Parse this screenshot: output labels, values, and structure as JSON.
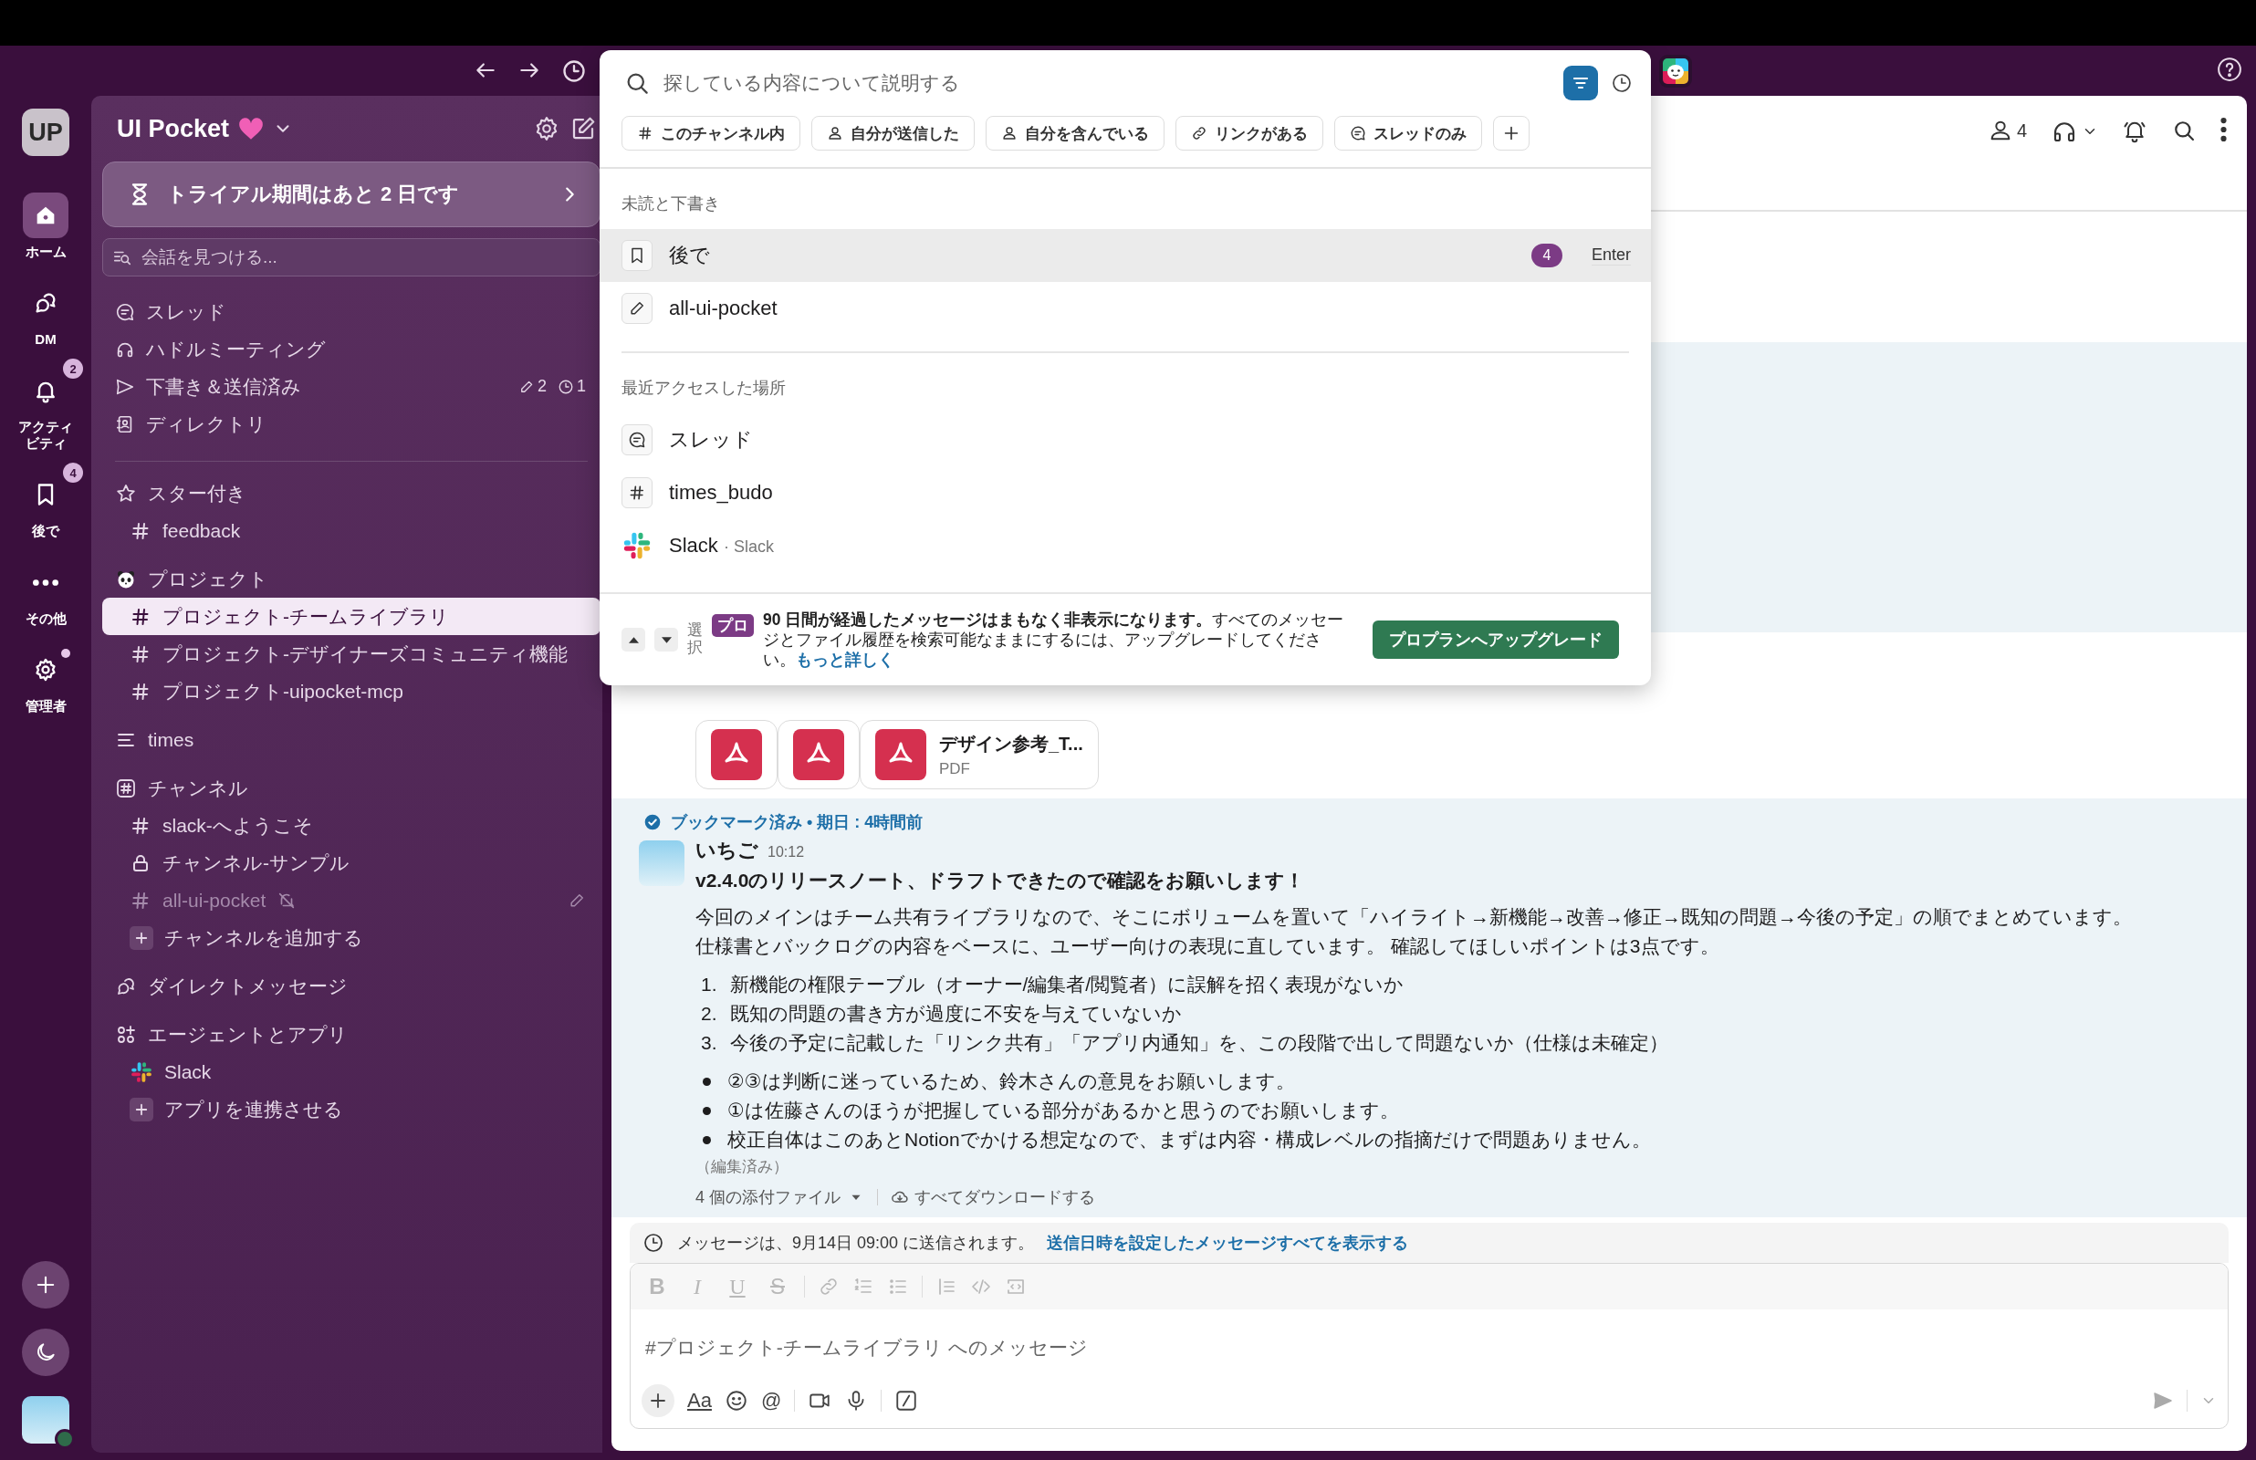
{
  "rail": {
    "workspace_initials": "UP",
    "items": [
      {
        "kind": "home",
        "label": "ホーム",
        "selected": true,
        "dot": false
      },
      {
        "kind": "dm",
        "label": "DM",
        "selected": false,
        "dot": false
      },
      {
        "kind": "activity",
        "label": "アクティビティ",
        "selected": false,
        "badge": "2",
        "dot": false
      },
      {
        "kind": "later",
        "label": "後で",
        "selected": false,
        "badge": "4",
        "dot": false
      },
      {
        "kind": "more",
        "label": "その他",
        "selected": false,
        "dot": false
      },
      {
        "kind": "admin",
        "label": "管理者",
        "selected": false,
        "dot": true
      }
    ]
  },
  "sidebar": {
    "workspace": "UI Pocket",
    "trial_banner": "トライアル期間はあと 2 日です",
    "find_placeholder": "会話を見つける...",
    "nav": [
      {
        "kind": "threads",
        "label": "スレッド"
      },
      {
        "kind": "huddle",
        "label": "ハドルミーティング"
      },
      {
        "kind": "drafts",
        "label": "下書き＆送信済み",
        "draft_count": "2",
        "scheduled_count": "1"
      },
      {
        "kind": "directory",
        "label": "ディレクトリ"
      }
    ],
    "sections": [
      {
        "kind": "star",
        "title": "スター付き",
        "items": [
          {
            "kind": "hash",
            "label": "feedback",
            "selected": false,
            "muted": false,
            "draft": false
          }
        ]
      },
      {
        "kind": "project",
        "title": "プロジェクト",
        "items": [
          {
            "kind": "hash",
            "label": "プロジェクト-チームライブラリ",
            "selected": true,
            "muted": false,
            "draft": false
          },
          {
            "kind": "hash",
            "label": "プロジェクト-デザイナーズコミュニティ機能",
            "selected": false,
            "muted": false,
            "draft": false
          },
          {
            "kind": "hash",
            "label": "プロジェクト-uipocket-mcp",
            "selected": false,
            "muted": false,
            "draft": false
          }
        ]
      },
      {
        "kind": "list",
        "title": "times"
      },
      {
        "kind": "channels",
        "title": "チャンネル",
        "items": [
          {
            "kind": "hash",
            "label": "slack-へようこそ",
            "selected": false,
            "muted": false,
            "draft": false
          },
          {
            "kind": "lock",
            "label": "チャンネル-サンプル",
            "selected": false,
            "muted": false,
            "draft": false
          },
          {
            "kind": "hash",
            "label": "all-ui-pocket",
            "selected": false,
            "muted": true,
            "draft": true
          },
          {
            "kind": "add",
            "label": "チャンネルを追加する",
            "selected": false,
            "muted": false,
            "draft": false
          }
        ]
      },
      {
        "kind": "dm",
        "title": "ダイレクトメッセージ"
      },
      {
        "kind": "apps",
        "title": "エージェントとアプリ",
        "items": [
          {
            "kind": "app",
            "label": "Slack",
            "selected": false,
            "muted": false,
            "draft": false
          },
          {
            "kind": "add",
            "label": "アプリを連携させる",
            "selected": false,
            "muted": false,
            "draft": false
          }
        ]
      }
    ]
  },
  "channel_header": {
    "member_count": "4"
  },
  "messages": {
    "attachments": [
      {
        "kind": "pdf"
      },
      {
        "kind": "pdf"
      },
      {
        "kind": "pdf",
        "name": "デザイン参考_T...",
        "type": "PDF"
      }
    ],
    "message": {
      "bookmark_status": "ブックマーク済み • 期日 : 4時間前",
      "author": "いちご",
      "time": "10:12",
      "title": "v2.4.0のリリースノート、ドラフトできたので確認をお願いします！",
      "paragraph_lines": [
        "今回のメインはチーム共有ライブラリなので、そこにボリュームを置いて「ハイライト→新機能→改善→修正→既知の問題→今後の予定」の順でまとめています。",
        "仕様書とバックログの内容をベースに、ユーザー向けの表現に直しています。 確認してほしいポイントは3点です。"
      ],
      "numbered": [
        {
          "number": "1.",
          "text": "新機能の権限テーブル（オーナー/編集者/閲覧者）に誤解を招く表現がないか"
        },
        {
          "number": "2.",
          "text": "既知の問題の書き方が過度に不安を与えていないか"
        },
        {
          "number": "3.",
          "text": "今後の予定に記載した「リンク共有」「アプリ内通知」を、この段階で出して問題ないか（仕様は未確定）"
        }
      ],
      "bullets": [
        "②③は判断に迷っているため、鈴木さんの意見をお願いします。",
        "①は佐藤さんのほうが把握している部分があるかと思うのでお願いします。",
        "校正自体はこのあとNotionでかける想定なので、まずは内容・構成レベルの指摘だけで問題ありません。"
      ],
      "edited": "（編集済み）",
      "attachment_count": "4 個の添付ファイル",
      "download_all": "すべてダウンロードする"
    }
  },
  "scheduled_notice": {
    "text": "メッセージは、9月14日 09:00 に送信されます。",
    "link": "送信日時を設定したメッセージすべてを表示する"
  },
  "composer": {
    "format_buttons": [
      {
        "kind": "bold",
        "glyph": "B"
      },
      {
        "kind": "italic",
        "glyph": "I"
      },
      {
        "kind": "underline",
        "glyph": "U"
      },
      {
        "kind": "strike",
        "glyph": "S"
      }
    ],
    "placeholder": "#プロジェクト-チームライブラリ へのメッセージ",
    "text_format": "Aa",
    "mention": "@"
  },
  "search": {
    "placeholder": "探している内容について説明する",
    "filters": [
      {
        "kind": "hash",
        "label": "このチャンネル内"
      },
      {
        "kind": "person",
        "label": "自分が送信した"
      },
      {
        "kind": "person",
        "label": "自分を含んでいる"
      },
      {
        "kind": "link",
        "label": "リンクがある"
      },
      {
        "kind": "thread",
        "label": "スレッドのみ"
      }
    ],
    "sections": [
      {
        "title": "未読と下書き",
        "items": [
          {
            "kind": "bookmark",
            "label": "後で",
            "badge": "4",
            "shortcut": "Enter",
            "selected": true
          },
          {
            "kind": "pencil",
            "label": "all-ui-pocket",
            "selected": false
          }
        ]
      },
      {
        "title": "最近アクセスした場所",
        "items": [
          {
            "kind": "thread",
            "label": "スレッド",
            "selected": false
          },
          {
            "kind": "hash",
            "label": "times_budo",
            "selected": false
          },
          {
            "kind": "app",
            "label": "Slack",
            "sub": "· Slack",
            "selected": false
          }
        ]
      }
    ],
    "footer": {
      "select_hint": "選択",
      "plan_badge": "プロ",
      "notice": "**90 日間が経過したメッセージはまもなく非表示になります。**すべてのメッセージとファイル履歴を検索可能なままにするには、アップグレードしてください。",
      "link": "もっと詳しく",
      "button": "プロプランへアップグレード"
    }
  }
}
